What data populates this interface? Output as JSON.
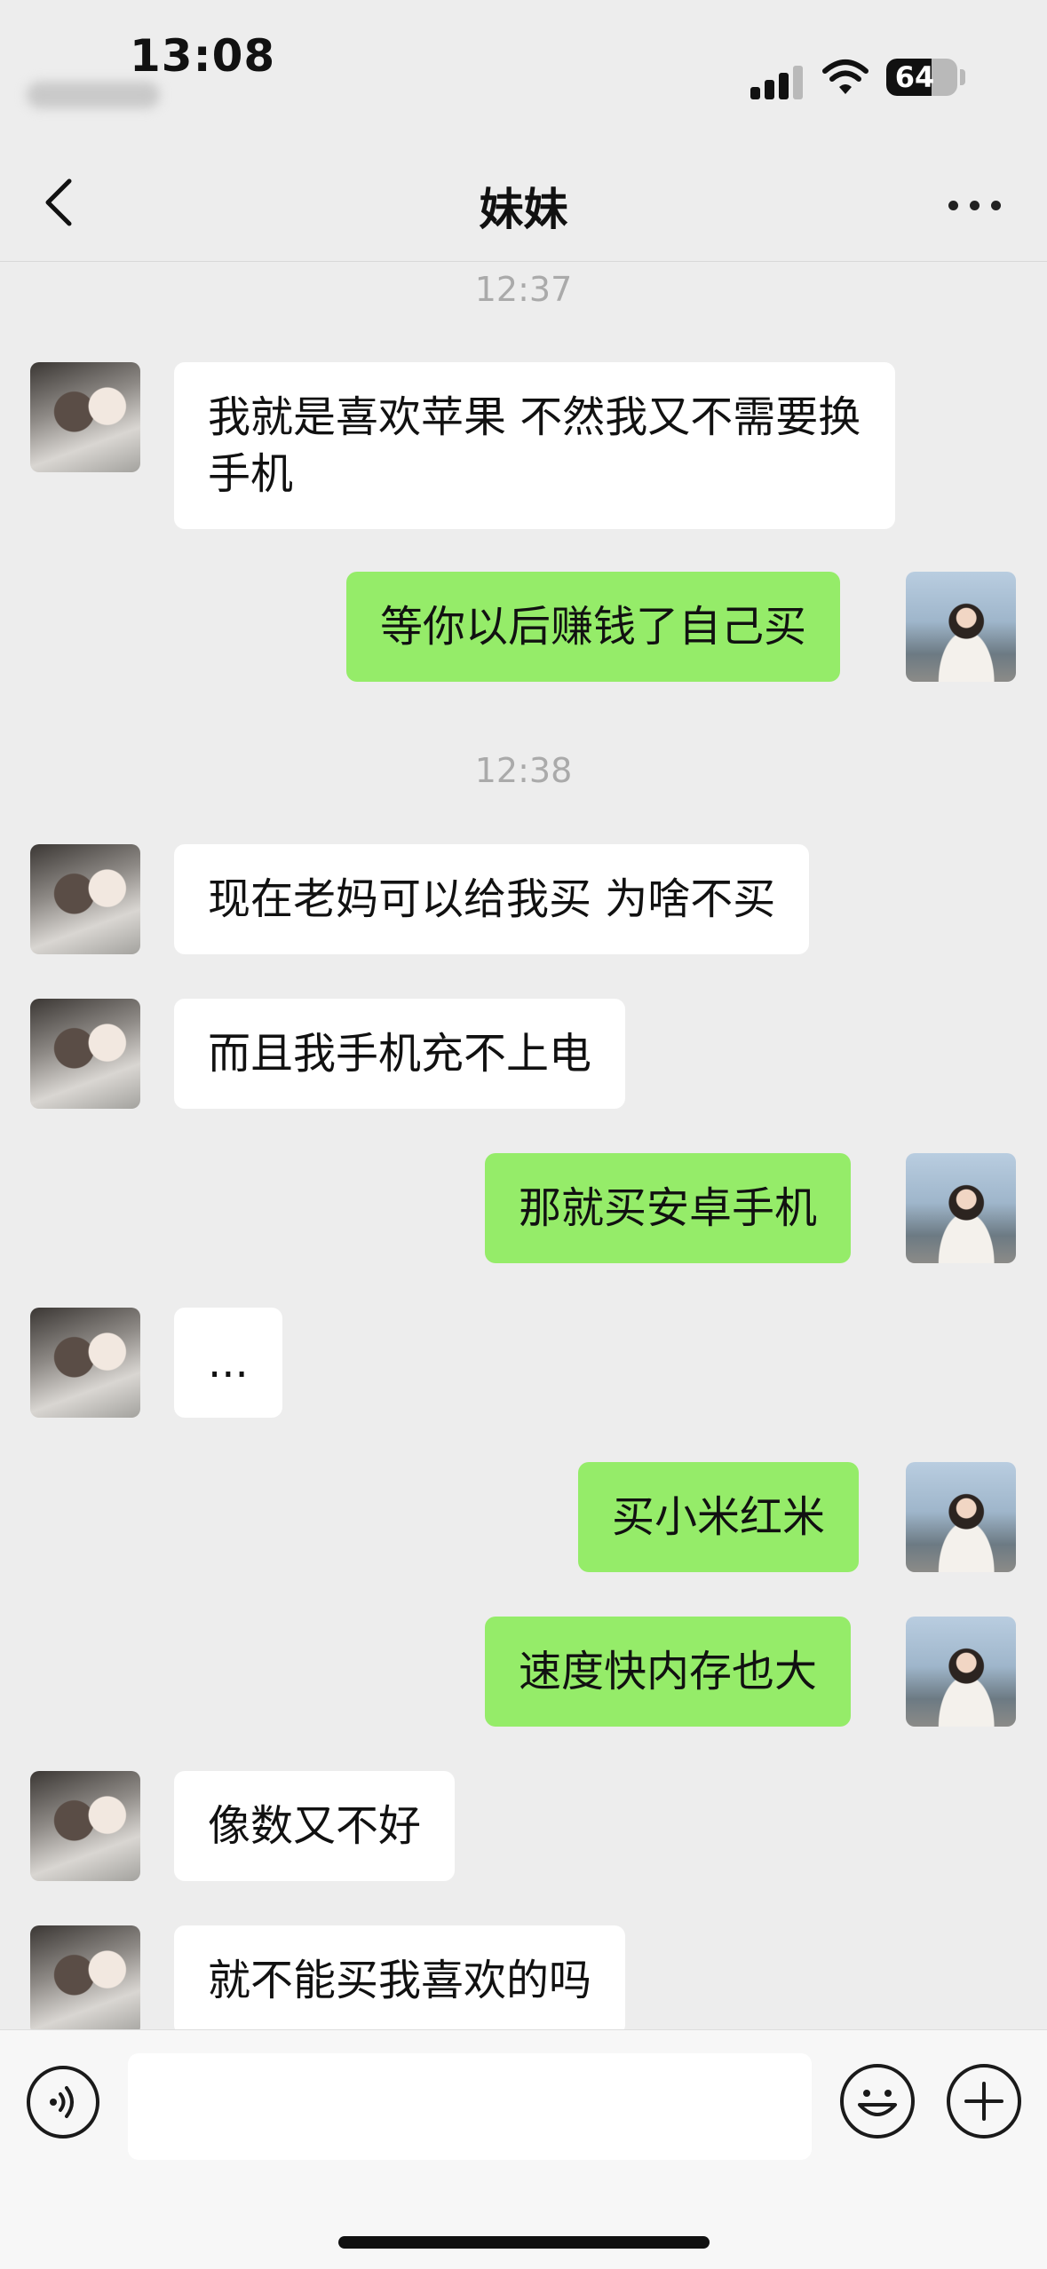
{
  "status_bar": {
    "time": "13:08",
    "battery": "64",
    "battery_level": 0.64,
    "signal_icon": "cellular-signal-icon",
    "wifi_icon": "wifi-icon"
  },
  "nav": {
    "title": "妹妹",
    "back_icon": "chevron-left-icon",
    "more_icon": "more-dots-icon"
  },
  "messages": [
    {
      "time": "12:37"
    },
    {
      "from": "other",
      "text": "我就是喜欢苹果 不然我又不需要换手机"
    },
    {
      "from": "me",
      "text": "等你以后赚钱了自己买"
    },
    {
      "time": "12:38"
    },
    {
      "from": "other",
      "text": "现在老妈可以给我买 为啥不买"
    },
    {
      "from": "other",
      "text": "而且我手机充不上电"
    },
    {
      "from": "me",
      "text": "那就买安卓手机"
    },
    {
      "from": "other",
      "text": "..."
    },
    {
      "from": "me",
      "text": "买小米红米"
    },
    {
      "from": "me",
      "text": "速度快内存也大"
    },
    {
      "from": "other",
      "text": "像数又不好"
    },
    {
      "from": "other",
      "text": "就不能买我喜欢的吗"
    }
  ],
  "input_bar": {
    "voice_icon": "voice-icon",
    "emoji_icon": "emoji-icon",
    "plus_icon": "plus-icon",
    "text_value": ""
  },
  "colors": {
    "background": "#ededed",
    "my_bubble": "#95ec69",
    "other_bubble": "#ffffff",
    "time_label": "#aaaaaa"
  }
}
